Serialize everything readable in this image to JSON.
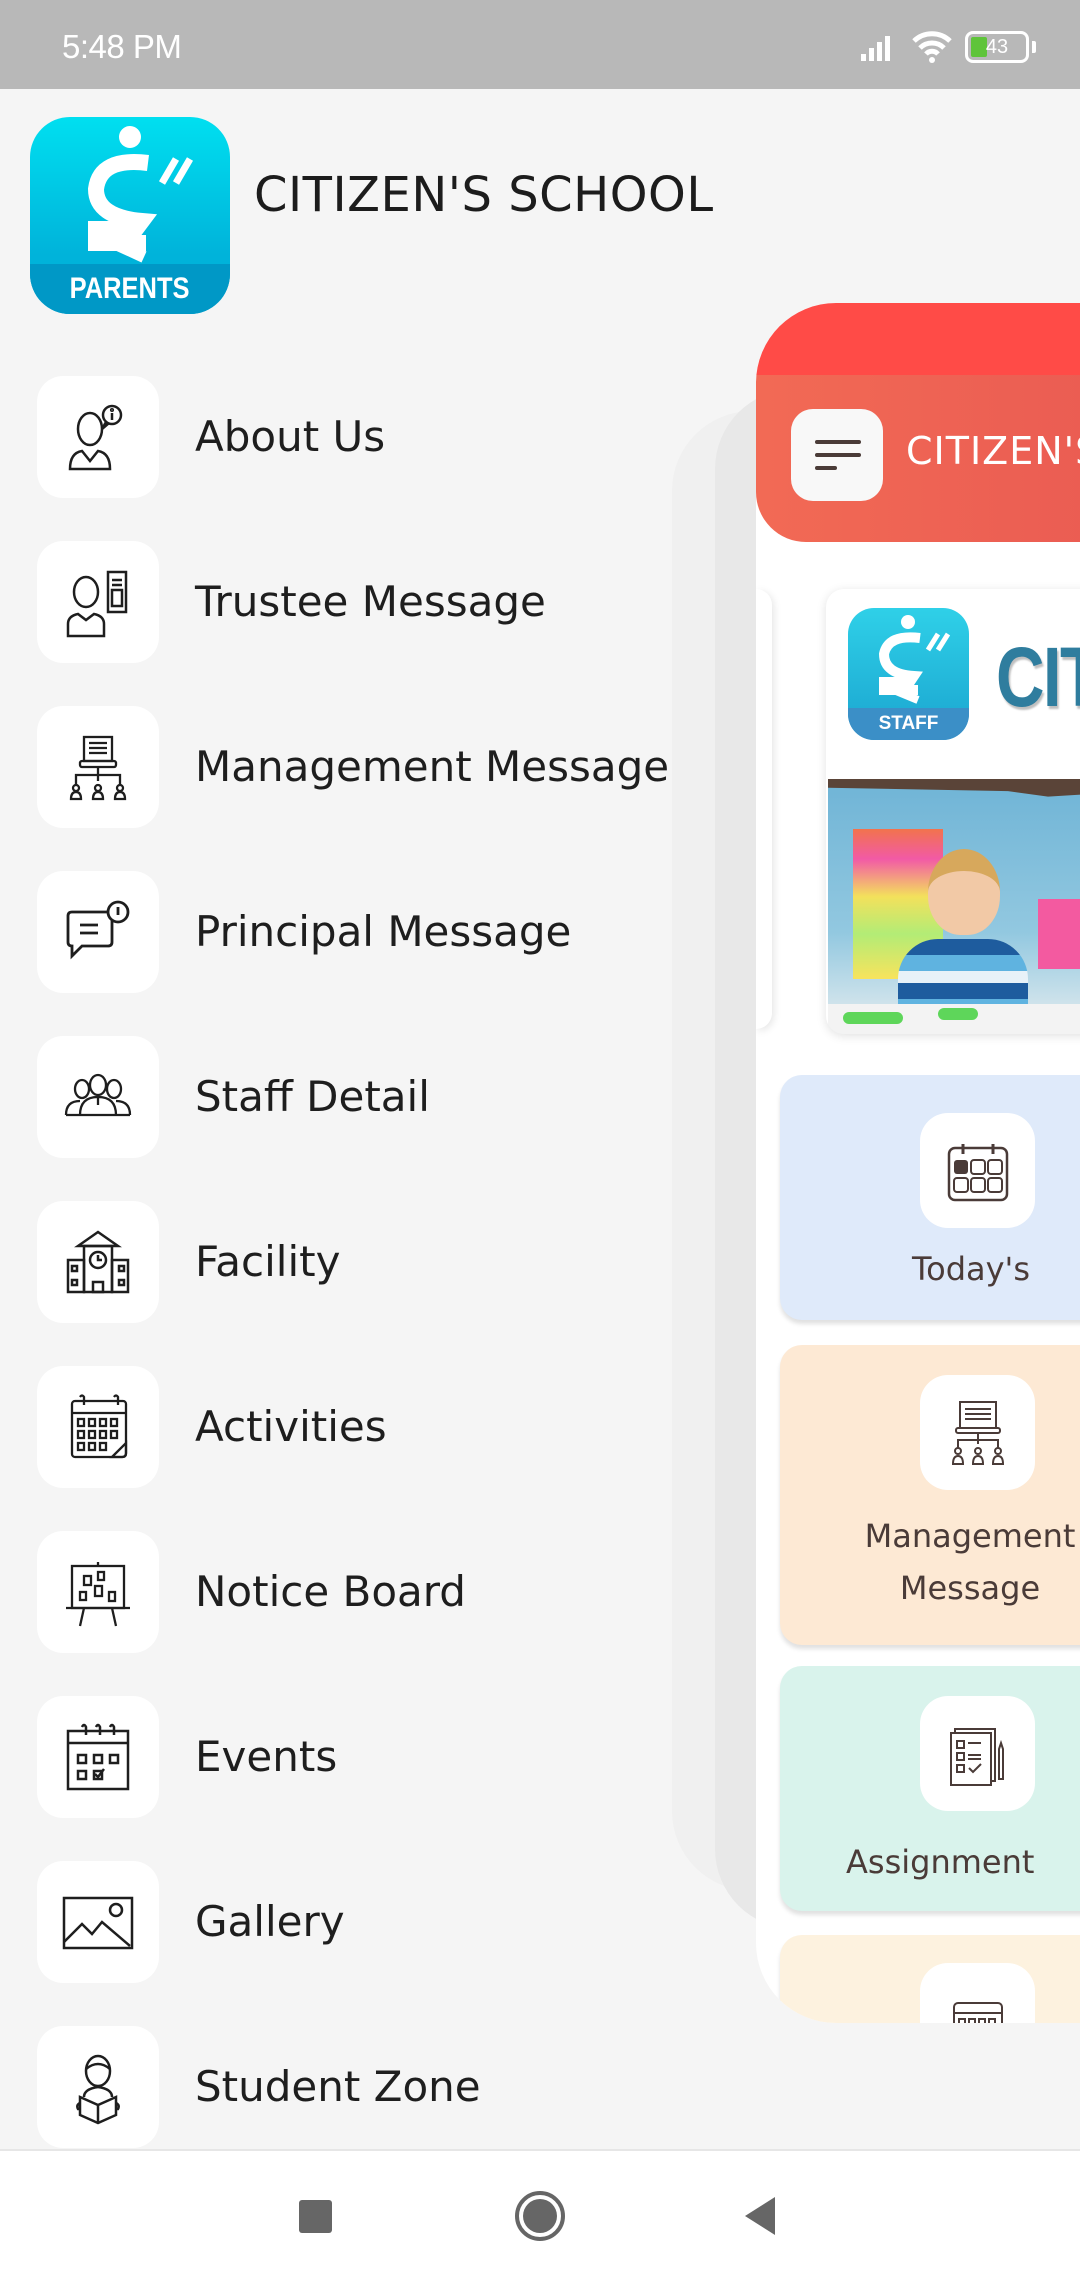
{
  "status_bar": {
    "time": "5:48 PM",
    "battery_level": "43",
    "icons": [
      "signal-icon",
      "wifi-icon",
      "battery-icon"
    ]
  },
  "drawer": {
    "logo_badge": "PARENTS",
    "school_name": "CITIZEN'S SCHOOL",
    "items": [
      {
        "label": "About Us",
        "icon": "about-person-info-icon"
      },
      {
        "label": "Trustee Message",
        "icon": "trustee-message-icon"
      },
      {
        "label": "Management Message",
        "icon": "management-hierarchy-icon"
      },
      {
        "label": "Principal Message",
        "icon": "chat-bubble-alert-icon"
      },
      {
        "label": "Staff Detail",
        "icon": "people-group-icon"
      },
      {
        "label": "Facility",
        "icon": "school-building-icon"
      },
      {
        "label": "Activities",
        "icon": "calendar-grid-icon"
      },
      {
        "label": "Notice Board",
        "icon": "notice-board-easel-icon"
      },
      {
        "label": "Events",
        "icon": "calendar-check-icon"
      },
      {
        "label": "Gallery",
        "icon": "image-picture-icon"
      },
      {
        "label": "Student Zone",
        "icon": "student-reading-icon"
      }
    ]
  },
  "main_page": {
    "header_title": "CITIZEN'S SCHOOL",
    "banner": {
      "logo_badge": "STAFF",
      "title_fragment": "CIT"
    },
    "tiles": [
      {
        "label": "Today's",
        "icon": "calendar-today-icon",
        "color": "#dfeafa"
      },
      {
        "label": "Management Message",
        "icon": "management-hierarchy-icon",
        "color": "#fde9d4"
      },
      {
        "label": "Assignment",
        "icon": "assignment-checklist-icon",
        "color": "#d9f3ec"
      },
      {
        "label": "",
        "icon": "calendar-icon",
        "color": "#fdf2df"
      }
    ],
    "header_color": "#ff4b47"
  },
  "nav_bar": {
    "buttons": [
      "recents",
      "home",
      "back"
    ]
  }
}
